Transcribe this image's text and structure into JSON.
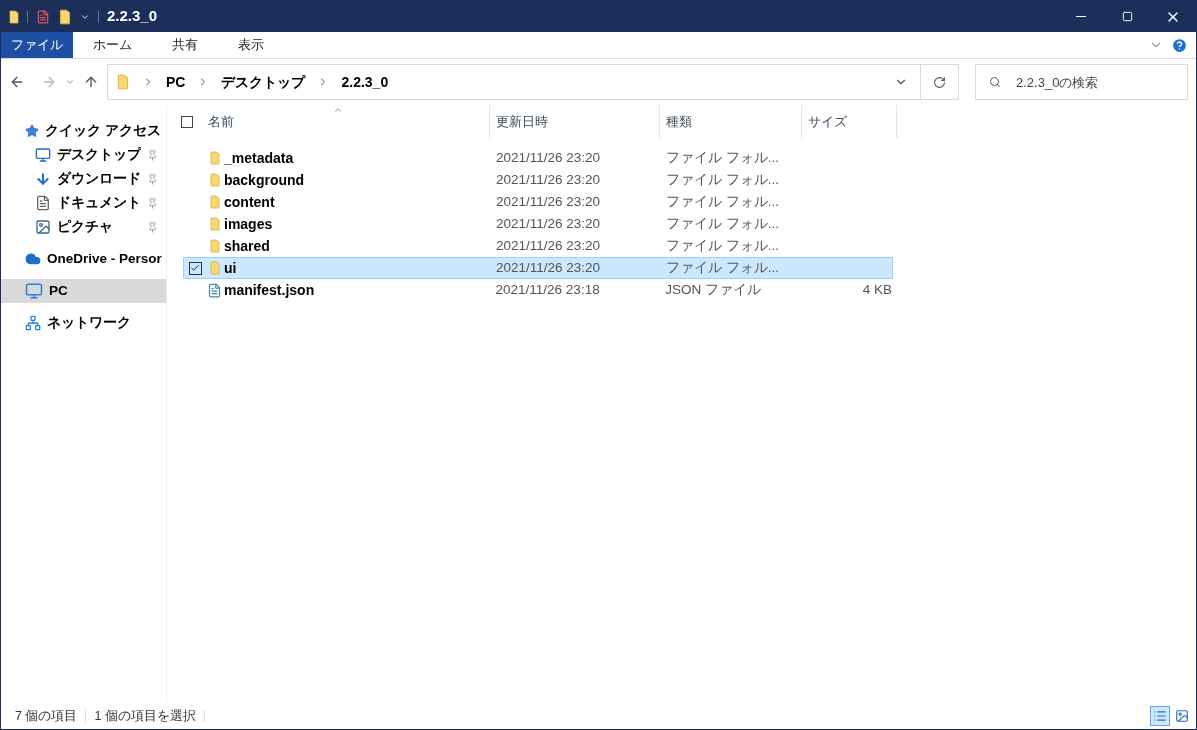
{
  "window": {
    "title": "2.2.3_0"
  },
  "ribbon_tabs": [
    {
      "label": "ファイル",
      "selected": true
    },
    {
      "label": "ホーム",
      "selected": false
    },
    {
      "label": "共有",
      "selected": false
    },
    {
      "label": "表示",
      "selected": false
    }
  ],
  "breadcrumb": [
    "PC",
    "デスクトップ",
    "2.2.3_0"
  ],
  "search": {
    "placeholder": "2.2.3_0の検索"
  },
  "sidebar": [
    {
      "label": "クイック アクセス",
      "selected": false,
      "children": [
        {
          "label": "デスクトップ",
          "pinned": true,
          "selected": false
        },
        {
          "label": "ダウンロード",
          "pinned": true,
          "selected": false
        },
        {
          "label": "ドキュメント",
          "pinned": true,
          "selected": false
        },
        {
          "label": "ピクチャ",
          "pinned": true,
          "selected": false
        }
      ]
    },
    {
      "label": "OneDrive - Persor",
      "selected": false
    },
    {
      "label": "PC",
      "selected": true
    },
    {
      "label": "ネットワーク",
      "selected": false
    }
  ],
  "select_all": {
    "checked": false
  },
  "table": {
    "columns": [
      "名前",
      "更新日時",
      "種類",
      "サイズ"
    ],
    "rows": [
      {
        "name": "_metadata",
        "kind": "folder",
        "date": "2021/11/26 23:20",
        "type": "ファイル フォル...",
        "selected": false
      },
      {
        "name": "background",
        "kind": "folder",
        "date": "2021/11/26 23:20",
        "type": "ファイル フォル...",
        "selected": false
      },
      {
        "name": "content",
        "kind": "folder",
        "date": "2021/11/26 23:20",
        "type": "ファイル フォル...",
        "selected": false
      },
      {
        "name": "images",
        "kind": "folder",
        "date": "2021/11/26 23:20",
        "type": "ファイル フォル...",
        "selected": false
      },
      {
        "name": "shared",
        "kind": "folder",
        "date": "2021/11/26 23:20",
        "type": "ファイル フォル...",
        "selected": false
      },
      {
        "name": "ui",
        "kind": "folder",
        "date": "2021/11/26 23:20",
        "type": "ファイル フォル...",
        "selected": true
      },
      {
        "name": "manifest.json",
        "kind": "file",
        "date": "2021/11/26 23:18",
        "type": "JSON ファイル",
        "size": "4 KB",
        "selected": false
      }
    ]
  },
  "status_bar": {
    "item_count": "7 個の項目",
    "selection": "1 個の項目を選択"
  },
  "view_buttons": [
    {
      "kind": "details",
      "selected": true
    },
    {
      "kind": "large_icons",
      "selected": false
    }
  ]
}
